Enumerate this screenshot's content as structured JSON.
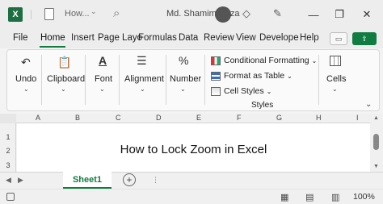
{
  "titlebar": {
    "app_icon": "X",
    "doc_title": "How...",
    "user_name": "Md. Shamim Reza"
  },
  "tabs": [
    "File",
    "Home",
    "Insert",
    "Page Layo",
    "Formulas",
    "Data",
    "Review",
    "View",
    "Develope",
    "Help"
  ],
  "ribbon": {
    "undo": "Undo",
    "clipboard": "Clipboard",
    "font": "Font",
    "alignment": "Alignment",
    "number": "Number",
    "conditional_formatting": "Conditional Formatting",
    "format_as_table": "Format as Table",
    "cell_styles": "Cell Styles",
    "styles_group": "Styles",
    "cells": "Cells"
  },
  "columns": [
    "A",
    "B",
    "C",
    "D",
    "E",
    "F",
    "G",
    "H",
    "I"
  ],
  "rows": [
    "1",
    "2",
    "3"
  ],
  "cell_title": "How to Lock Zoom in Excel",
  "sheet_tab": "Sheet1",
  "status": {
    "zoom": "100%"
  },
  "colors": {
    "accent": "#107c41"
  }
}
